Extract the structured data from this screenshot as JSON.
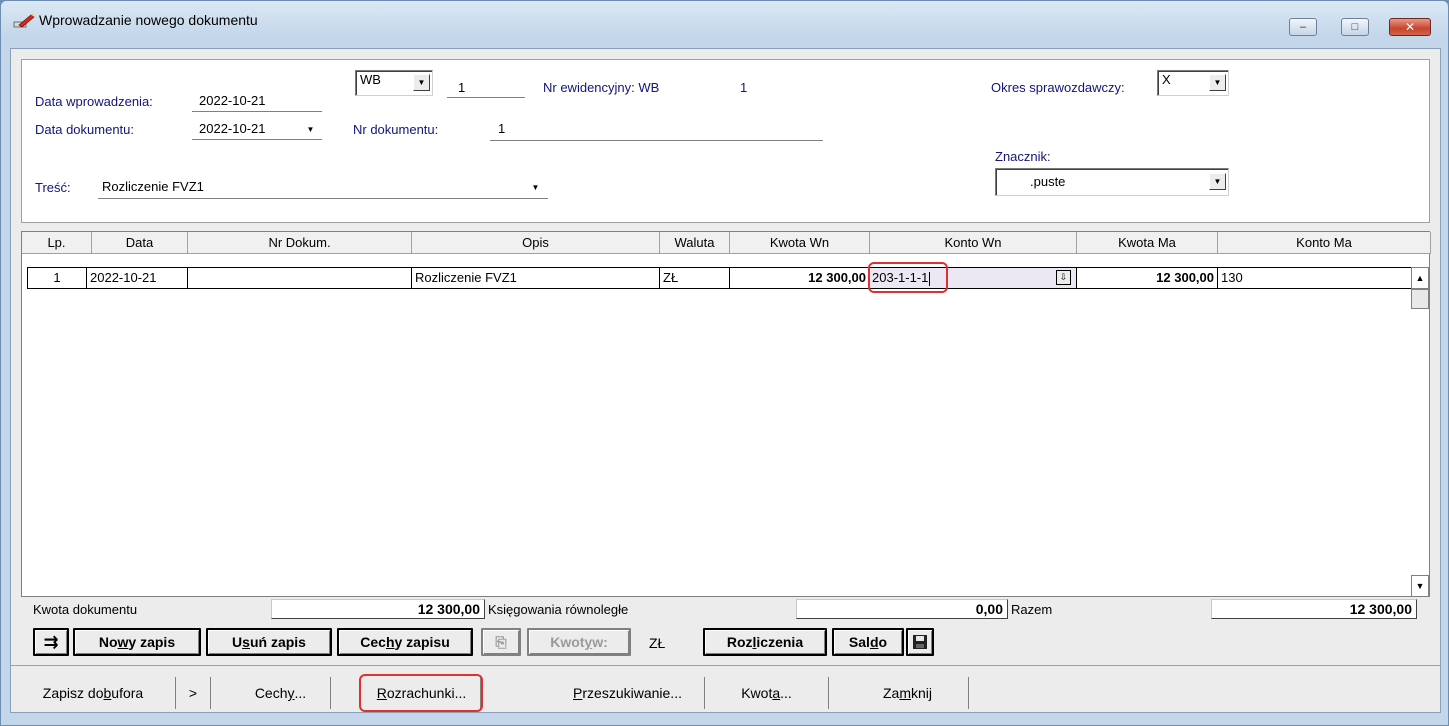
{
  "window": {
    "title": "Wprowadzanie nowego dokumentu",
    "controls": {
      "minimize": "–",
      "maximize": "□",
      "close": "✕"
    }
  },
  "header": {
    "data_wprowadzenia_label": "Data wprowadzenia:",
    "data_wprowadzenia_value": "2022-10-21",
    "data_dokumentu_label": "Data dokumentu:",
    "data_dokumentu_value": "2022-10-21",
    "doc_type_value": "WB",
    "doc_number_value": "1",
    "nr_ewidencyjny_label": "Nr ewidencyjny: WB",
    "nr_ewidencyjny_value": "1",
    "nr_dokumentu_label": "Nr dokumentu:",
    "nr_dokumentu_value": "1",
    "okres_label": "Okres sprawozdawczy:",
    "okres_value": "X",
    "znacznik_label": "Znacznik:",
    "znacznik_value": ".puste",
    "tresc_label": "Treść:",
    "tresc_value": "Rozliczenie FVZ1"
  },
  "grid": {
    "columns": [
      "Lp.",
      "Data",
      "Nr Dokum.",
      "Opis",
      "Waluta",
      "Kwota Wn",
      "Konto Wn",
      "Kwota Ma",
      "Konto Ma"
    ],
    "rows": [
      {
        "lp": "1",
        "data": "2022-10-21",
        "nr_dokum": "",
        "opis": "Rozliczenie FVZ1",
        "waluta": "ZŁ",
        "kwota_wn": "12 300,00",
        "konto_wn": "203-1-1-1",
        "kwota_ma": "12 300,00",
        "konto_ma": "130"
      }
    ]
  },
  "summary": {
    "kwota_dokumentu_label": "Kwota dokumentu",
    "kwota_dokumentu_value": "12 300,00",
    "ksiegowania_label": "Księgowania równoległe",
    "ksiegowania_value": "0,00",
    "razem_label": "Razem",
    "razem_value": "12 300,00"
  },
  "actions": {
    "nowy_zapis": {
      "pre": "No",
      "ul": "w",
      "post": "y zapis"
    },
    "usun_zapis": {
      "pre": "U",
      "ul": "s",
      "post": "uń zapis"
    },
    "cechy_zapisu": {
      "pre": "Cec",
      "ul": "h",
      "post": "y zapisu"
    },
    "kwoty_w": {
      "pre": "Kwot",
      "ul": "y",
      "post": " w:"
    },
    "currency": "ZŁ",
    "rozliczenia": {
      "pre": "Roz",
      "ul": "l",
      "post": "iczenia"
    },
    "saldo": {
      "pre": "Sal",
      "ul": "d",
      "post": "o"
    }
  },
  "toolbar": {
    "zapisz": {
      "pre": "Zapisz do ",
      "ul": "b",
      "post": "ufora"
    },
    "more": ">",
    "cechy": {
      "pre": "Cech",
      "ul": "y",
      "post": "..."
    },
    "rozrachunki": {
      "pre": "",
      "ul": "R",
      "post": "ozrachunki..."
    },
    "przeszukiwanie": {
      "pre": "",
      "ul": "P",
      "post": "rzeszukiwanie..."
    },
    "kwota": {
      "pre": "Kwot",
      "ul": "a",
      "post": "..."
    },
    "zamknij": {
      "pre": "Za",
      "ul": "m",
      "post": "knij"
    }
  },
  "colors": {
    "label_blue": "#14147a",
    "highlight_red": "#e03030",
    "window_frame": "#c4d6ea"
  }
}
